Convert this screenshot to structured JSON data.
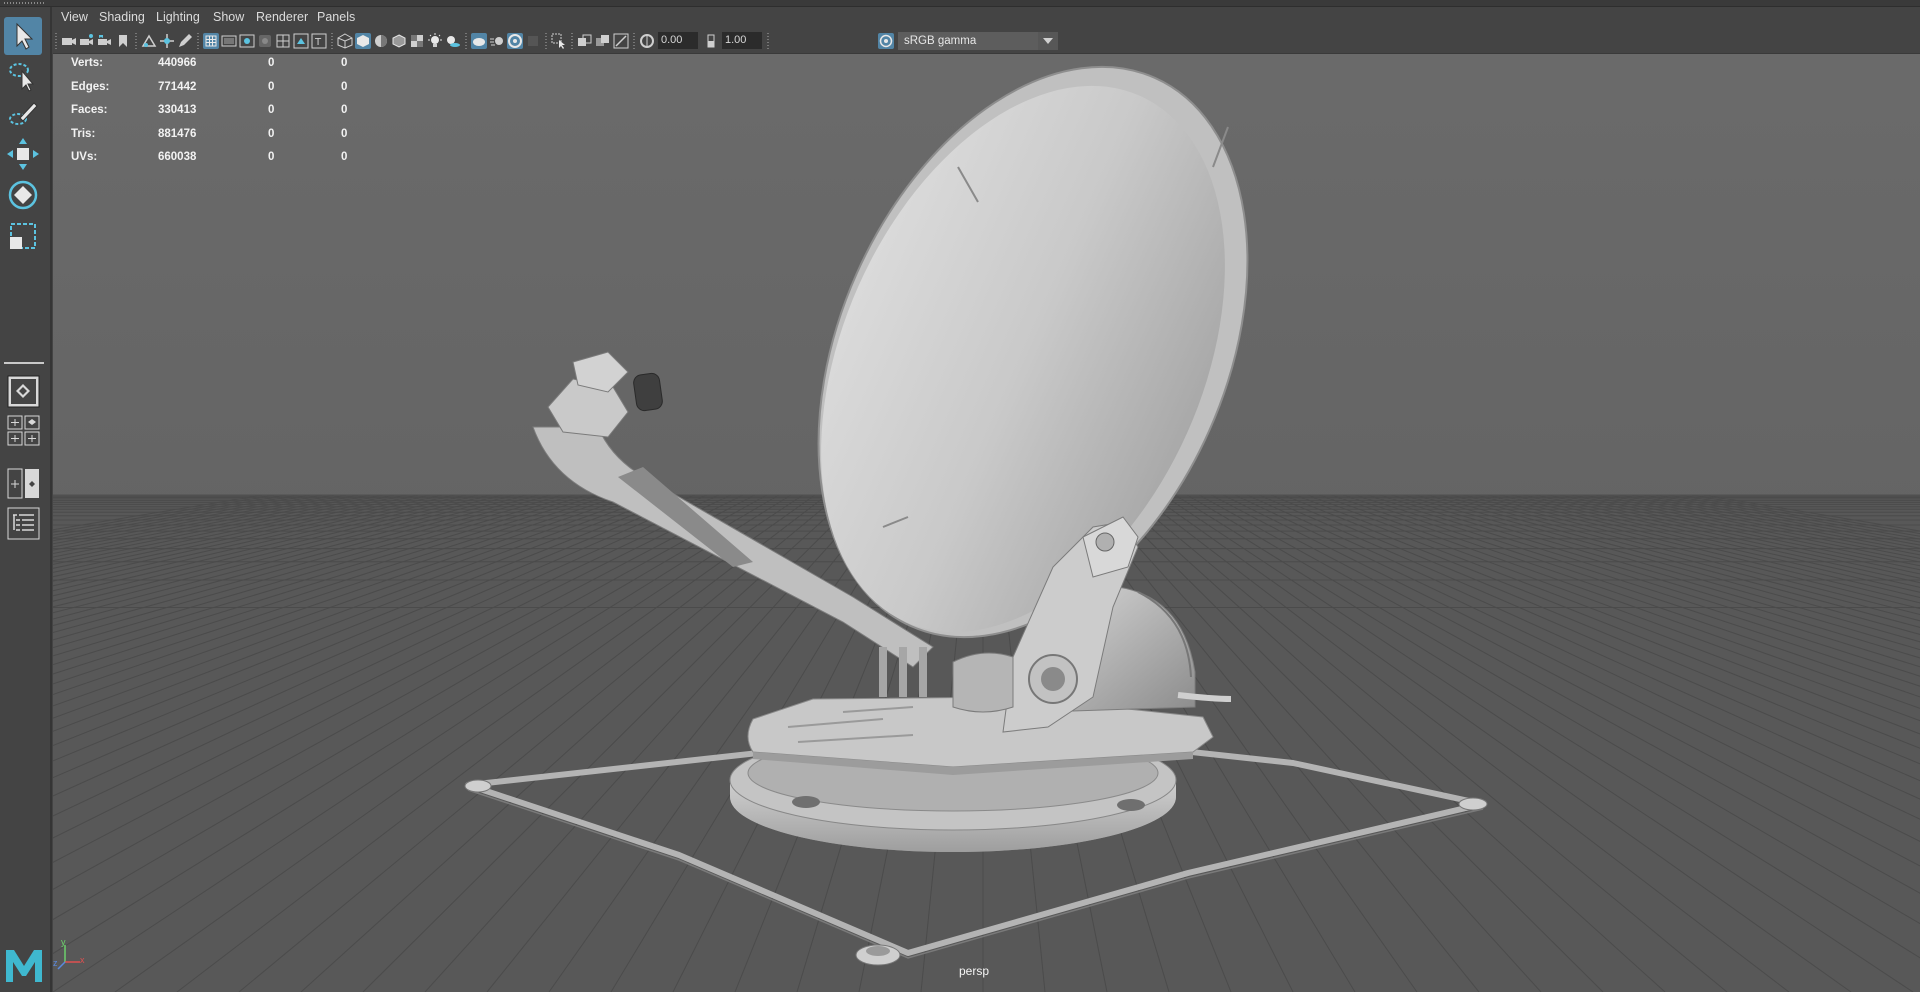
{
  "menubar": {
    "items": [
      "View",
      "Shading",
      "Lighting",
      "Show",
      "Renderer",
      "Panels"
    ]
  },
  "toolbar": {
    "exposure_value": "0.00",
    "gamma_value": "1.00",
    "color_management": "sRGB gamma"
  },
  "hud": {
    "rows": [
      {
        "label": "Verts:",
        "total": "440966",
        "selected": "0",
        "components": "0"
      },
      {
        "label": "Edges:",
        "total": "771442",
        "selected": "0",
        "components": "0"
      },
      {
        "label": "Faces:",
        "total": "330413",
        "selected": "0",
        "components": "0"
      },
      {
        "label": "Tris:",
        "total": "881476",
        "selected": "0",
        "components": "0"
      },
      {
        "label": "UVs:",
        "total": "660038",
        "selected": "0",
        "components": "0"
      }
    ]
  },
  "viewport": {
    "camera": "persp",
    "axis_labels": {
      "x": "x",
      "y": "y",
      "z": "z"
    }
  },
  "toolbox": {
    "tools": [
      "select-tool",
      "lasso-tool",
      "paint-select-tool",
      "move-tool",
      "rotate-tool",
      "scale-tool"
    ],
    "active_tool": "select-tool"
  },
  "colors": {
    "accent": "#5285a6",
    "panel": "#444444",
    "viewport_bg": "#6a6a6a",
    "grid": "#555555",
    "logo": "#3fb8cf"
  }
}
